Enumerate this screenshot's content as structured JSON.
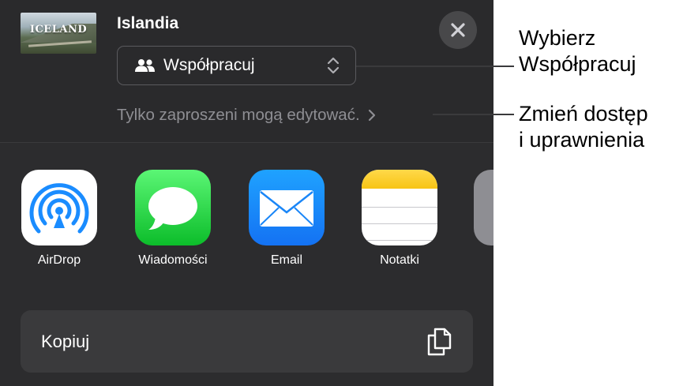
{
  "document": {
    "title": "Islandia",
    "thumbnail_text": "ICELAND"
  },
  "collaboration": {
    "mode_label": "Współpracuj",
    "access_text": "Tylko zaproszeni mogą edytować."
  },
  "apps": [
    {
      "label": "AirDrop",
      "icon": "airdrop-icon"
    },
    {
      "label": "Wiadomości",
      "icon": "messages-icon"
    },
    {
      "label": "Email",
      "icon": "mail-icon"
    },
    {
      "label": "Notatki",
      "icon": "notes-icon"
    }
  ],
  "actions": {
    "copy_label": "Kopiuj"
  },
  "callouts": {
    "choose_collaborate": "Wybierz\nWspółpracuj",
    "change_access": "Zmień dostęp\ni uprawnienia"
  },
  "colors": {
    "sheet_background": "#2c2c2e",
    "secondary_text": "#8e8e93",
    "row_background": "#3a3a3c"
  }
}
